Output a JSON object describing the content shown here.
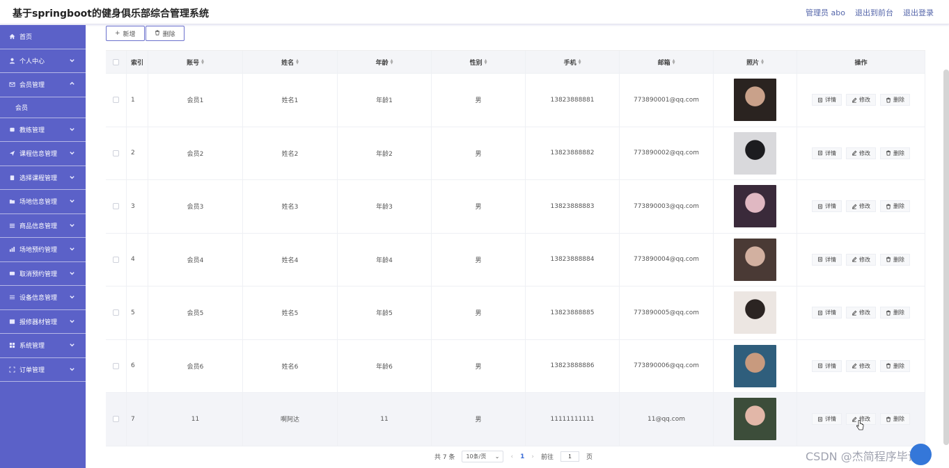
{
  "header": {
    "title": "基于springboot的健身俱乐部综合管理系统",
    "user": "管理员 abo",
    "back_to_front": "退出到前台",
    "logout": "退出登录"
  },
  "sidebar": {
    "items": [
      {
        "label": "首页",
        "icon": "home-icon"
      },
      {
        "label": "个人中心",
        "icon": "user-icon"
      },
      {
        "label": "会员管理",
        "icon": "mail-icon"
      },
      {
        "label": "会员",
        "icon": ""
      },
      {
        "label": "教练管理",
        "icon": "document-icon"
      },
      {
        "label": "课程信息管理",
        "icon": "send-icon"
      },
      {
        "label": "选择课程管理",
        "icon": "clipboard-icon"
      },
      {
        "label": "场地信息管理",
        "icon": "folder-icon"
      },
      {
        "label": "商品信息管理",
        "icon": "menu-icon"
      },
      {
        "label": "场地预约管理",
        "icon": "chart-icon"
      },
      {
        "label": "取消预约管理",
        "icon": "message-icon"
      },
      {
        "label": "设备信息管理",
        "icon": "sliders-icon"
      },
      {
        "label": "报修器材管理",
        "icon": "picture-icon"
      },
      {
        "label": "系统管理",
        "icon": "grid-icon"
      },
      {
        "label": "订单管理",
        "icon": "scan-icon"
      }
    ]
  },
  "toolbar": {
    "add_label": "新增",
    "delete_label": "删除"
  },
  "table": {
    "columns": [
      "索引",
      "账号",
      "姓名",
      "年龄",
      "性别",
      "手机",
      "邮箱",
      "照片",
      "操作"
    ],
    "rows": [
      {
        "index": "1",
        "account": "会员1",
        "name": "姓名1",
        "age": "年龄1",
        "gender": "男",
        "phone": "13823888881",
        "email": "773890001@qq.com"
      },
      {
        "index": "2",
        "account": "会员2",
        "name": "姓名2",
        "age": "年龄2",
        "gender": "男",
        "phone": "13823888882",
        "email": "773890002@qq.com"
      },
      {
        "index": "3",
        "account": "会员3",
        "name": "姓名3",
        "age": "年龄3",
        "gender": "男",
        "phone": "13823888883",
        "email": "773890003@qq.com"
      },
      {
        "index": "4",
        "account": "会员4",
        "name": "姓名4",
        "age": "年龄4",
        "gender": "男",
        "phone": "13823888884",
        "email": "773890004@qq.com"
      },
      {
        "index": "5",
        "account": "会员5",
        "name": "姓名5",
        "age": "年龄5",
        "gender": "男",
        "phone": "13823888885",
        "email": "773890005@qq.com"
      },
      {
        "index": "6",
        "account": "会员6",
        "name": "姓名6",
        "age": "年龄6",
        "gender": "男",
        "phone": "13823888886",
        "email": "773890006@qq.com"
      },
      {
        "index": "7",
        "account": "11",
        "name": "啊阿达",
        "age": "11",
        "gender": "男",
        "phone": "11111111111",
        "email": "11@qq.com"
      }
    ],
    "actions": {
      "detail": "详情",
      "edit": "修改",
      "delete": "删除"
    }
  },
  "pager": {
    "total": "共 7 条",
    "page_size": "10条/页",
    "current_page": "1",
    "goto_label": "前往",
    "goto_value": "1",
    "page_unit": "页"
  },
  "watermark": "CSDN @杰简程序毕设",
  "colors": {
    "sidebar": "#5b61c8",
    "accent": "#6a70cc",
    "page_link": "#3a6cd6"
  }
}
